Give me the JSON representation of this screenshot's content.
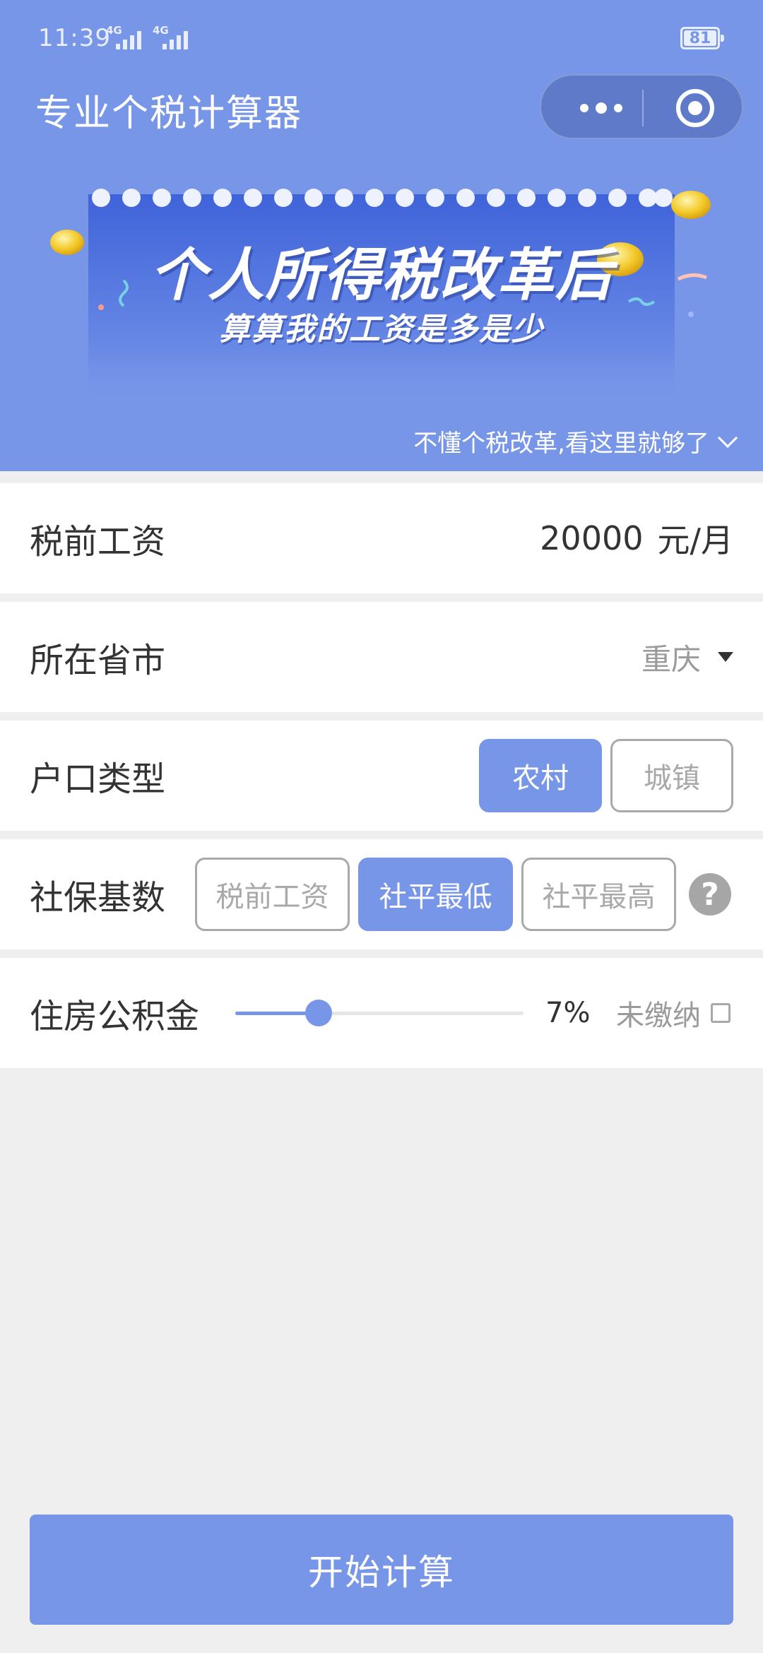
{
  "status_bar": {
    "time": "11:39",
    "signal1_tag": "4G",
    "signal2_tag": "4G",
    "battery": "81"
  },
  "header": {
    "title": "专业个税计算器"
  },
  "banner": {
    "line1": "个人所得税改革后",
    "line2": "算算我的工资是多是少"
  },
  "tax_link": "不懂个税改革,看这里就够了",
  "salary": {
    "label": "税前工资",
    "value": "20000",
    "unit": "元/月"
  },
  "city": {
    "label": "所在省市",
    "value": "重庆"
  },
  "hukou": {
    "label": "户口类型",
    "options": [
      "农村",
      "城镇"
    ],
    "selected": 0
  },
  "social": {
    "label": "社保基数",
    "options": [
      "税前工资",
      "社平最低",
      "社平最高"
    ],
    "selected": 1,
    "help": "?"
  },
  "fund": {
    "label": "住房公积金",
    "percent": "7%",
    "slider_fraction": 0.29,
    "unpaid_label": "未缴纳",
    "unpaid_checked": false
  },
  "calc_button": "开始计算",
  "colors": {
    "accent": "#7896e8",
    "background": "#efefef"
  }
}
